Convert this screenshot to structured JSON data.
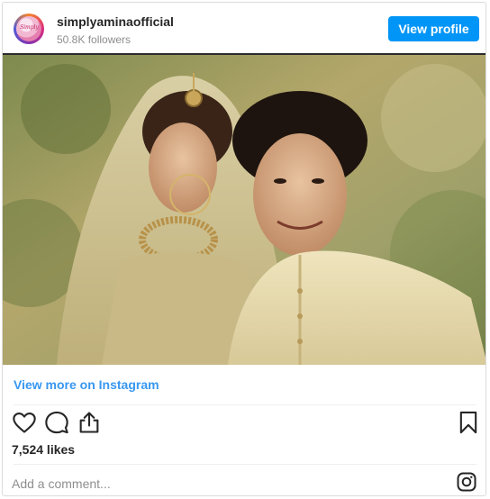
{
  "post": {
    "username": "simplyaminaofficial",
    "followers": "50.8K followers",
    "view_profile_label": "View profile",
    "view_more_label": "View more on Instagram",
    "likes": "7,524 likes",
    "comment_placeholder": "Add a comment...",
    "avatar_text": "Simply"
  },
  "icons": {
    "like": "heart-icon",
    "comment": "comment-icon",
    "share": "share-icon",
    "save": "bookmark-icon",
    "instagram": "instagram-icon"
  },
  "colors": {
    "accent": "#0095f6",
    "link": "#3897f0",
    "text": "#262626",
    "muted": "#8e8e8e"
  }
}
